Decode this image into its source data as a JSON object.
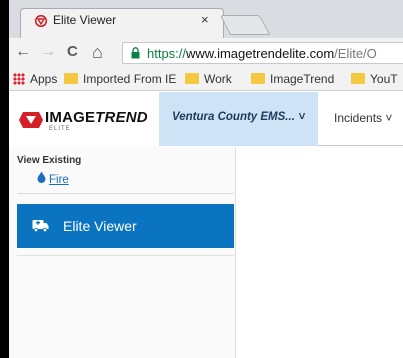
{
  "browser": {
    "tab": {
      "title": "Elite Viewer",
      "close": "×"
    },
    "nav": {
      "back": "←",
      "forward": "→",
      "reload": "C",
      "home": "⌂"
    },
    "address": {
      "protocol": "https://",
      "host": "www.imagetrendelite.com",
      "path": "/Elite/O"
    },
    "bookmarks": [
      {
        "label": "Apps"
      },
      {
        "label": "Imported From IE"
      },
      {
        "label": "Work"
      },
      {
        "label": "ImageTrend"
      },
      {
        "label": "YouT"
      }
    ]
  },
  "app": {
    "logo": {
      "text_main": "IMAGE",
      "text_italic": "TREND",
      "sub": "ELITE"
    },
    "agency": "Ventura County EMS... ˅",
    "menu": {
      "incidents": "Incidents ˅"
    },
    "sidebar": {
      "heading": "View Existing",
      "link": "Fire",
      "button": "Elite Viewer"
    }
  },
  "colors": {
    "primary": "#0a74c1",
    "agency_bg": "#cfe3f6",
    "brand_red": "#d32029",
    "link": "#1b6fc2"
  }
}
